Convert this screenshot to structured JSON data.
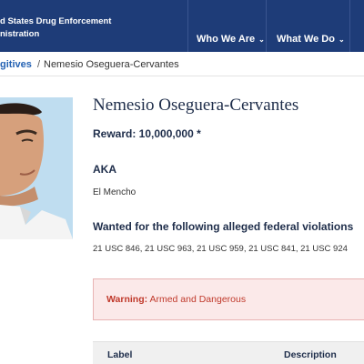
{
  "header": {
    "agency_line1": "d States Drug Enforcement",
    "agency_line2": "nistration",
    "nav": [
      {
        "label": "Who We Are"
      },
      {
        "label": "What We Do"
      },
      {
        "label": ""
      }
    ],
    "chevron": "⌄"
  },
  "breadcrumb": {
    "parent": "gitives",
    "separator": "/",
    "current": "Nemesio Oseguera-Cervantes"
  },
  "profile": {
    "name": "Nemesio Oseguera-Cervantes",
    "reward": "Reward: 10,000,000 *",
    "aka_heading": "AKA",
    "aka_value": "El Mencho",
    "violations_heading": "Wanted for the following alleged federal violations",
    "violations_value": "21 USC 846, 21 USC 963, 21 USC 959, 21 USC 841, 21 USC 924"
  },
  "warning": {
    "label": "Warning:",
    "text": " Armed and Dangerous"
  },
  "table": {
    "headers": [
      "Label",
      "Description"
    ]
  },
  "colors": {
    "header_bg": "#1e3c78",
    "link": "#2462b3",
    "warning_text": "#c0392b",
    "warning_bg": "#fbe9e9",
    "photo_bg": "#b9d9ee"
  }
}
